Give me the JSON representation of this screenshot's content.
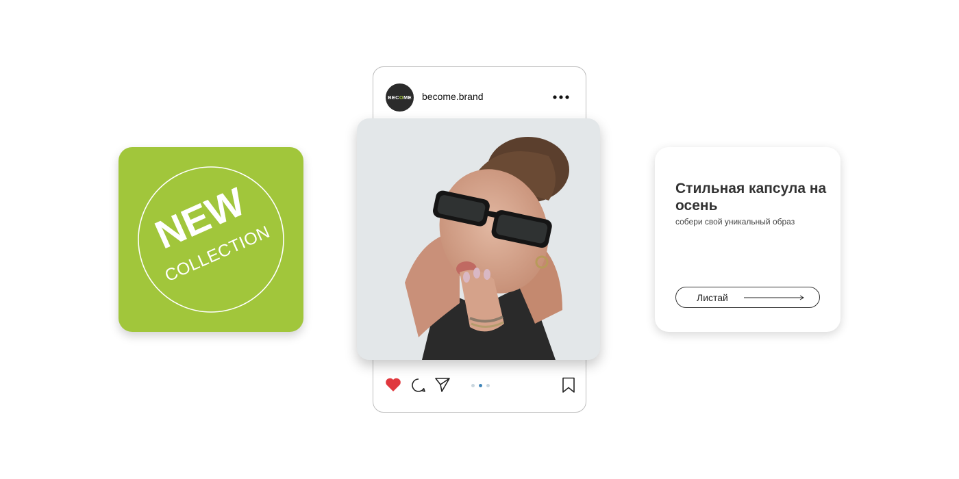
{
  "promo": {
    "badge_big": "NEW",
    "badge_small": "COLLECTION",
    "color": "#a1c63b"
  },
  "post": {
    "avatar_text_left": "BEC",
    "avatar_text_o": "O",
    "avatar_text_right": "ME",
    "username": "become.brand",
    "more_icon": "more-horizontal-icon",
    "liked": true,
    "heart_color": "#e0383e",
    "carousel_total": 3,
    "carousel_active": 2,
    "carousel_active_color": "#3f85b9",
    "photo": "woman-in-sunglasses-photo"
  },
  "info": {
    "title": "Стильная капсула на осень",
    "subtitle": "собери свой уникальный образ",
    "button_label": "Листай"
  }
}
